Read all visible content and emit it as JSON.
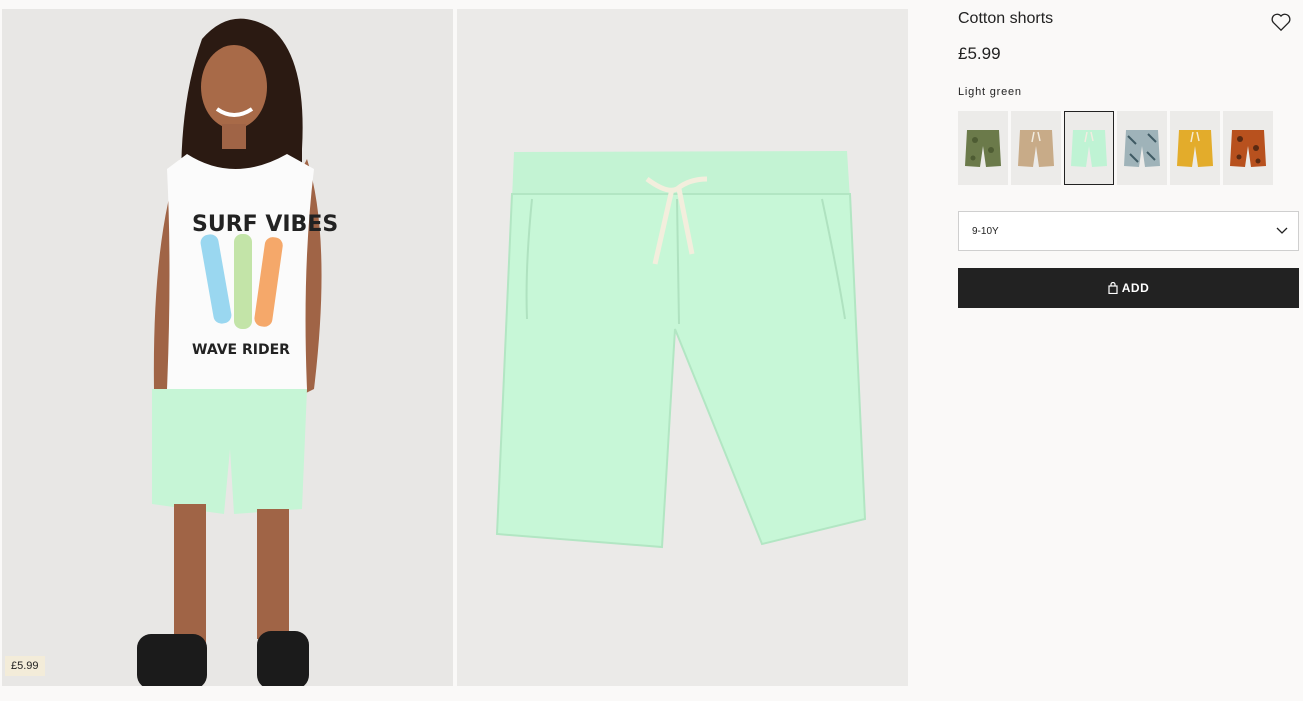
{
  "product": {
    "title": "Cotton shorts",
    "price": "£5.99",
    "color_name": "Light green"
  },
  "gallery": {
    "model_price_tag": "£5.99",
    "tank_top_text_1": "SURF VIBES",
    "tank_top_text_2": "WAVE RIDER"
  },
  "swatches": [
    {
      "name": "khaki-print",
      "color": "#6b7a4a",
      "selected": false
    },
    {
      "name": "beige",
      "color": "#c8ab88",
      "selected": false
    },
    {
      "name": "light-green",
      "color": "#bff3d4",
      "selected": true
    },
    {
      "name": "palm-print",
      "color": "#8a9ea6",
      "selected": false
    },
    {
      "name": "yellow",
      "color": "#e3ac2b",
      "selected": false
    },
    {
      "name": "rust-print",
      "color": "#b8511e",
      "selected": false
    }
  ],
  "size_select": {
    "value": "9-10Y",
    "icon": "chevron-down-icon"
  },
  "add_button": {
    "label": "ADD",
    "icon": "shopping-bag-icon"
  },
  "colors": {
    "shorts": "#c6f5d6",
    "button_bg": "#222222",
    "price_tag_bg": "#f3ecd9"
  }
}
